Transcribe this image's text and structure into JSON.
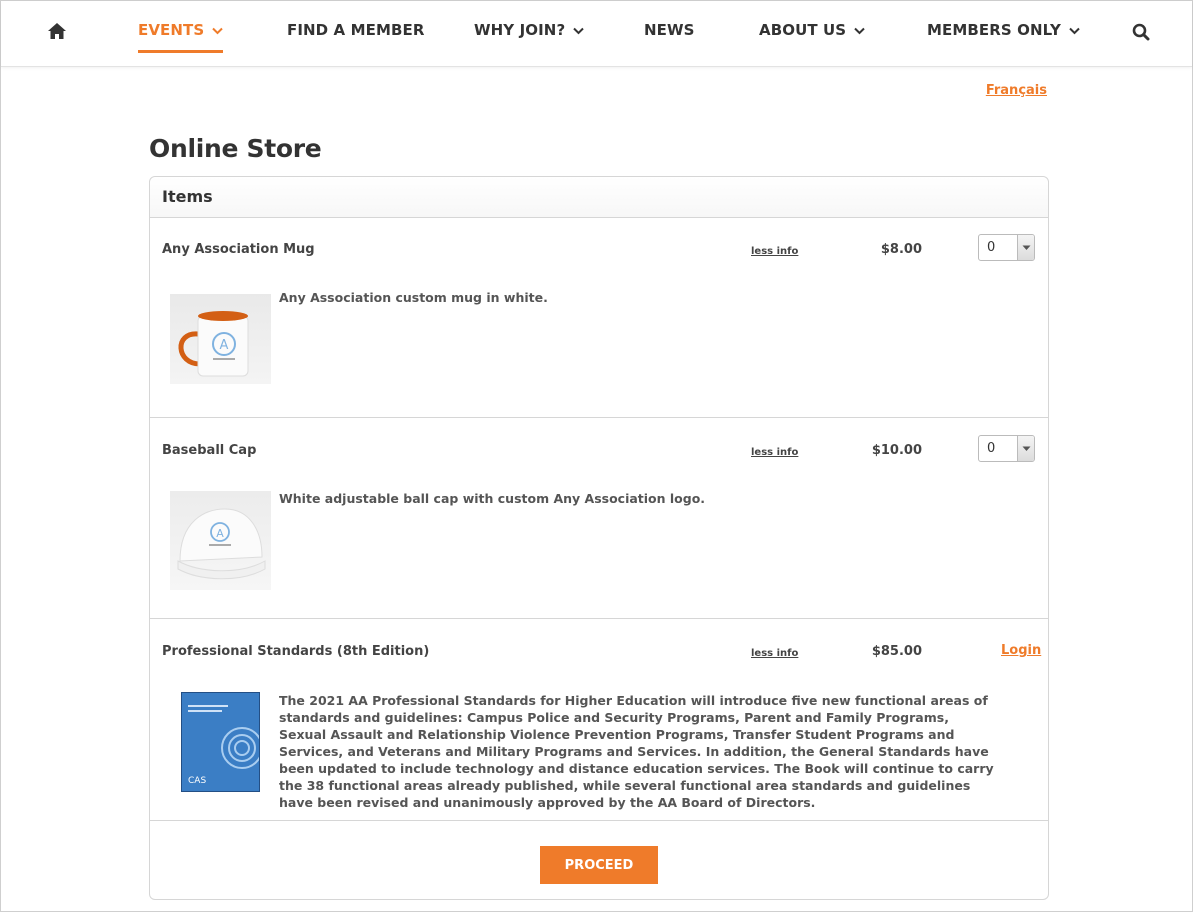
{
  "nav": {
    "items": [
      {
        "label": "EVENTS"
      },
      {
        "label": "FIND A MEMBER"
      },
      {
        "label": "WHY JOIN?"
      },
      {
        "label": "NEWS"
      },
      {
        "label": "ABOUT US"
      },
      {
        "label": "MEMBERS ONLY"
      }
    ]
  },
  "language_link": "Français",
  "page_title": "Online Store",
  "panel": {
    "header": "Items"
  },
  "items": [
    {
      "name": "Any Association Mug",
      "info_link": "less info",
      "price": "$8.00",
      "qty": "0",
      "description": "Any Association custom mug in white."
    },
    {
      "name": "Baseball Cap",
      "info_link": "less info",
      "price": "$10.00",
      "qty": "0",
      "description": "White adjustable ball cap with custom Any Association logo."
    },
    {
      "name": "Professional Standards (8th Edition)",
      "info_link": "less info",
      "price": "$85.00",
      "login_label": "Login",
      "description": "The 2021 AA Professional Standards for Higher Education will introduce five new functional areas of standards and guidelines: Campus Police and Security Programs, Parent and Family Programs, Sexual Assault and Relationship Violence Prevention Programs, Transfer Student Programs and Services, and Veterans and Military Programs and Services. In addition, the General Standards have been updated to include technology and distance education services. The Book will continue to carry the 38 functional areas already published, while several functional area standards and guidelines have been revised and unanimously approved by the AA Board of Directors."
    }
  ],
  "proceed_label": "PROCEED",
  "colors": {
    "accent": "#ef7b2a",
    "text": "#333333",
    "border": "#d6d6d6"
  }
}
